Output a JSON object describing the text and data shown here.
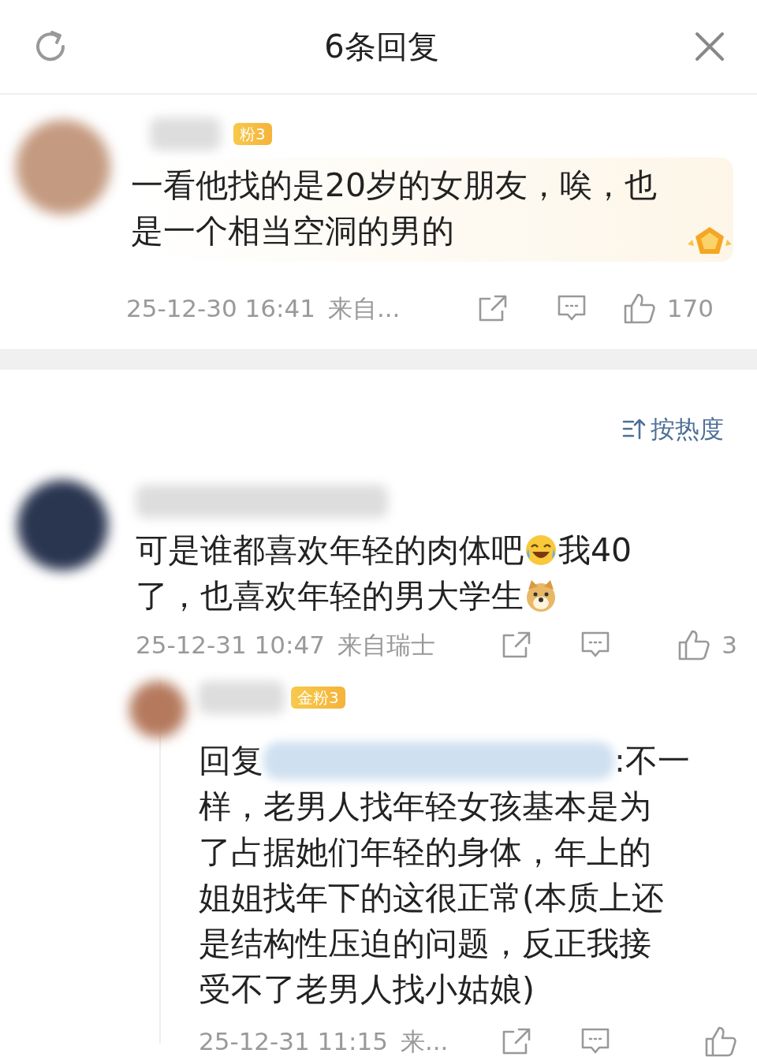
{
  "header": {
    "title": "6条回复"
  },
  "top_comment": {
    "badge": "粉3",
    "lines": [
      "一看他找的是20岁的女朋友，唉，也",
      "是一个相当空洞的男的"
    ],
    "time": "25-12-30 16:41",
    "source": "来自...",
    "likes": "170"
  },
  "sort": {
    "label": "按热度"
  },
  "comments": [
    {
      "lines": [
        [
          {
            "kind": "text",
            "text": "可是谁都喜欢年轻的肉体吧"
          },
          {
            "kind": "laugh"
          },
          {
            "kind": "text",
            "text": "我40"
          }
        ],
        [
          {
            "kind": "text",
            "text": "了，也喜欢年轻的男大学生"
          },
          {
            "kind": "doge"
          }
        ]
      ],
      "time": "25-12-31 10:47",
      "source": "来自瑞士",
      "likes": "3",
      "replies": [
        {
          "badge": "金粉3",
          "prefix": "回复",
          "first_line": ":不一",
          "lines": [
            "样，老男人找年轻女孩基本是为",
            "了占据她们年轻的身体，年上的",
            "姐姐找年下的这很正常(本质上还",
            "是结构性压迫的问题，反正我接",
            "受不了老男人找小姑娘)"
          ],
          "time": "25-12-31 11:15",
          "source": "来..."
        }
      ]
    }
  ]
}
